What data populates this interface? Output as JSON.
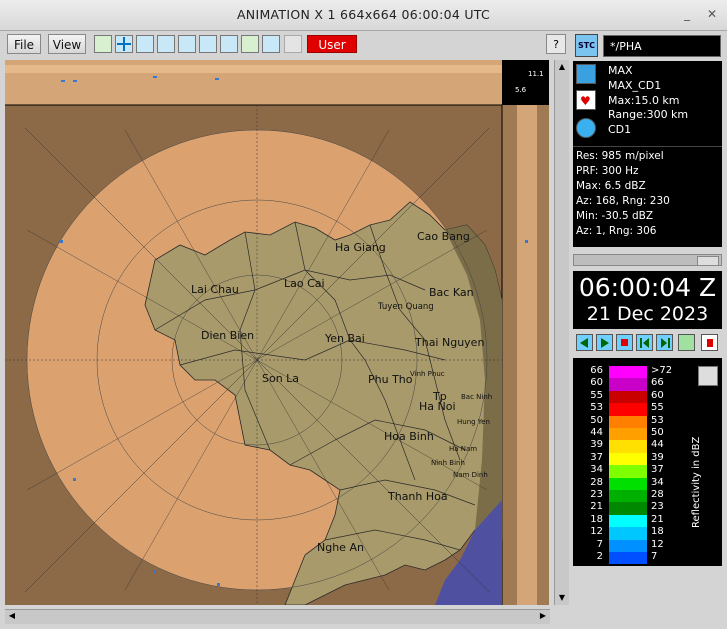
{
  "window": {
    "title": "ANIMATION X 1  664x664  06:00:04 UTC"
  },
  "toolbar": {
    "file_label": "File",
    "view_label": "View",
    "user_label": "User",
    "help_label": "?",
    "user_color": "#e00000"
  },
  "map": {
    "corner_values": [
      "11.1",
      "5.6"
    ],
    "places": [
      "Ha Giang",
      "Cao Bang",
      "Lai Chau",
      "Lao Cai",
      "Bac Kan",
      "Tuyen Quang",
      "Dien Bien",
      "Yen Bai",
      "Thai Nguyen",
      "Son La",
      "Phu Tho",
      "Vinh Phuc",
      "Bac Ninh",
      "Ha Noi",
      "Tp",
      "Ha Nam",
      "Hung Yen",
      "Hoa Binh",
      "Ninh Binh",
      "Nam Dinh",
      "Thanh Hoa",
      "Nghe An"
    ]
  },
  "sidebar": {
    "site": "*/PHA",
    "product": [
      "MAX",
      "MAX_CD1",
      "Max:15.0 km",
      "Range:300 km",
      "CD1"
    ],
    "info": [
      "Res: 985 m/pixel",
      "PRF: 300 Hz",
      "Max:  6.5 dBZ",
      "Az:  168, Rng: 230",
      "Min: -30.5 dBZ",
      "Az:  1, Rng: 306"
    ],
    "time": "06:00:04 Z",
    "date": "21 Dec 2023"
  },
  "legend": {
    "left_values": [
      "66",
      "60",
      "55",
      "53",
      "50",
      "44",
      "39",
      "37",
      "34",
      "28",
      "23",
      "21",
      "18",
      "12",
      "7",
      "2"
    ],
    "right_values": [
      ">72",
      "66",
      "60",
      "55",
      "53",
      "50",
      "44",
      "39",
      "37",
      "34",
      "28",
      "23",
      "21",
      "18",
      "12",
      "7"
    ],
    "colors": [
      "#ff00ff",
      "#c800c8",
      "#c80000",
      "#ff0000",
      "#ff8000",
      "#ffa000",
      "#ffe000",
      "#ffff00",
      "#80ff00",
      "#00e000",
      "#00b000",
      "#008800",
      "#00ffff",
      "#00c8ff",
      "#0090ff",
      "#0050ff"
    ],
    "units": "Reflectivity in dBZ"
  }
}
